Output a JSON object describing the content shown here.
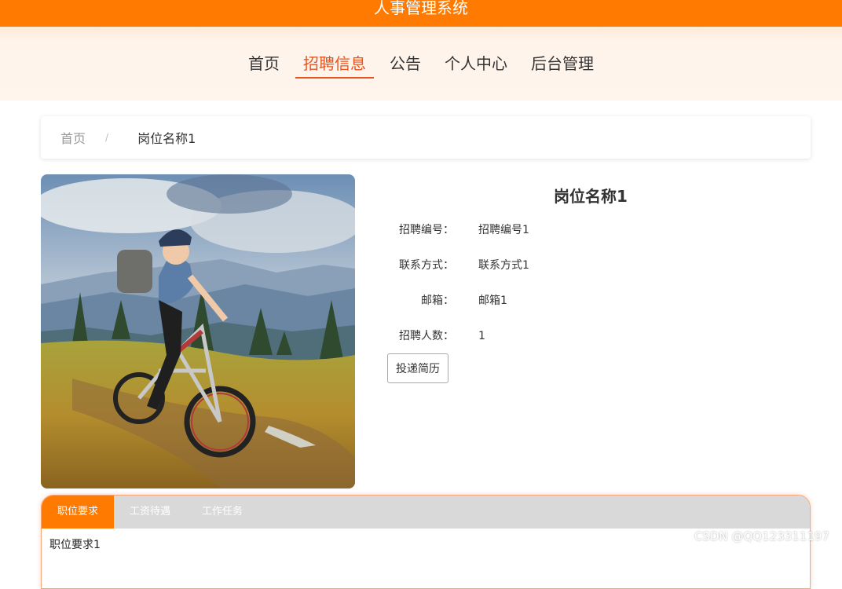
{
  "header": {
    "title": "人事管理系统"
  },
  "nav": {
    "items": [
      {
        "label": "首页"
      },
      {
        "label": "招聘信息",
        "active": true
      },
      {
        "label": "公告"
      },
      {
        "label": "个人中心"
      },
      {
        "label": "后台管理"
      }
    ]
  },
  "breadcrumb": {
    "home": "首页",
    "separator": "/",
    "current": "岗位名称1"
  },
  "job": {
    "title": "岗位名称1",
    "fields": [
      {
        "label": "招聘编号：",
        "value": "招聘编号1"
      },
      {
        "label": "联系方式：",
        "value": "联系方式1"
      },
      {
        "label": "邮箱：",
        "value": "邮箱1"
      },
      {
        "label": "招聘人数：",
        "value": "1"
      }
    ],
    "apply_label": "投递简历"
  },
  "tabs": {
    "items": [
      {
        "label": "职位要求",
        "active": true
      },
      {
        "label": "工资待遇"
      },
      {
        "label": "工作任务"
      }
    ],
    "content": "职位要求1"
  },
  "watermark": "CSDN @QQ123311197",
  "colors": {
    "accent": "#ff7a00",
    "active_nav": "#e8531f"
  }
}
